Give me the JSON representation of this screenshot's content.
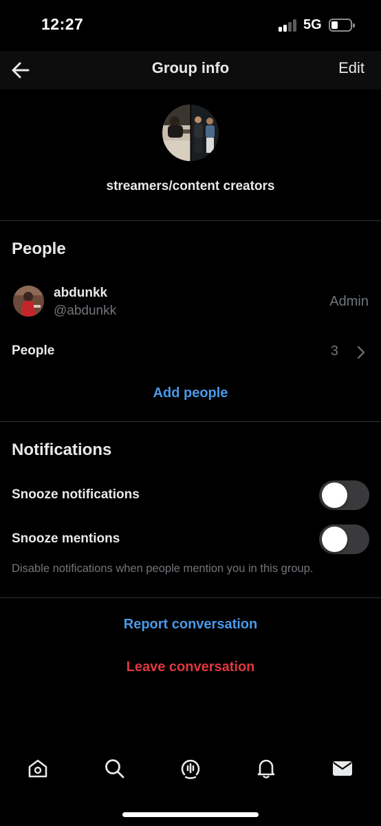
{
  "status_bar": {
    "time": "12:27",
    "network": "5G"
  },
  "header": {
    "title": "Group info",
    "edit_label": "Edit"
  },
  "group": {
    "name": "streamers/content creators"
  },
  "people_section": {
    "title": "People",
    "member": {
      "name": "abdunkk",
      "handle": "@abdunkk",
      "role": "Admin"
    },
    "people_row": {
      "label": "People",
      "count": "3"
    },
    "add_people_label": "Add people"
  },
  "notifications_section": {
    "title": "Notifications",
    "snooze_notifications": {
      "label": "Snooze notifications",
      "on": false
    },
    "snooze_mentions": {
      "label": "Snooze mentions",
      "on": false
    },
    "helper_text": "Disable notifications when people mention you in this group."
  },
  "actions": {
    "report_label": "Report conversation",
    "leave_label": "Leave conversation"
  },
  "bottom_nav": [
    "home-icon",
    "search-icon",
    "spaces-icon",
    "notifications-bell-icon",
    "messages-envelope-icon"
  ],
  "colors": {
    "accent_blue": "#4a99e9",
    "danger_red": "#e0383e",
    "muted_gray": "#71767b"
  }
}
